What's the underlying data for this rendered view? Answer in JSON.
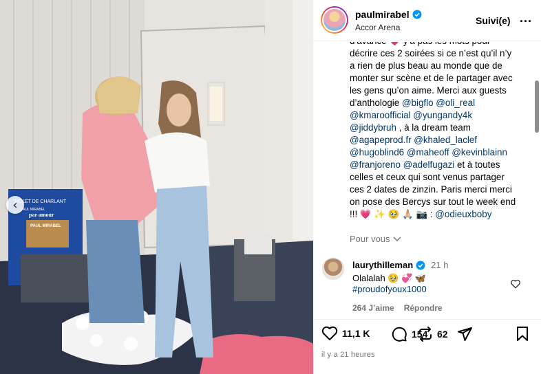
{
  "post": {
    "username": "paulmirabel",
    "location": "Accor Arena",
    "follow_label": "Suivi(e)",
    "more_label": "..."
  },
  "photo": {
    "ticket_line1": "TICKET DE CHARLANT",
    "ticket_line2": "PAUL MIRABEL",
    "ticket_line3": "par amour",
    "ticket_line4": "PAUL MIRABEL"
  },
  "caption": {
    "lines": [
      [
        {
          "t": "d’avance 💗 y’a pas les mots pour",
          "link": false
        }
      ],
      [
        {
          "t": "décrire ces 2 soirées si ce n’est qu’il n’y",
          "link": false
        }
      ],
      [
        {
          "t": "a rien de plus beau au monde que de",
          "link": false
        }
      ],
      [
        {
          "t": "monter sur scène et de le partager avec",
          "link": false
        }
      ],
      [
        {
          "t": "les gens qu’on aime. Merci aux guests",
          "link": false
        }
      ],
      [
        {
          "t": "d’anthologie ",
          "link": false
        },
        {
          "t": "@bigflo",
          "link": true
        },
        {
          "t": " ",
          "link": false
        },
        {
          "t": "@oli_real",
          "link": true
        }
      ],
      [
        {
          "t": "@kmaroofficial",
          "link": true
        },
        {
          "t": " ",
          "link": false
        },
        {
          "t": "@yungandy4k",
          "link": true
        }
      ],
      [
        {
          "t": "@jiddybruh",
          "link": true
        },
        {
          "t": " , à la dream team",
          "link": false
        }
      ],
      [
        {
          "t": "@agapeprod.fr",
          "link": true
        },
        {
          "t": " ",
          "link": false
        },
        {
          "t": "@khaled_laclef",
          "link": true
        }
      ],
      [
        {
          "t": "@hugoblind6",
          "link": true
        },
        {
          "t": " ",
          "link": false
        },
        {
          "t": "@maheoff",
          "link": true
        },
        {
          "t": " ",
          "link": false
        },
        {
          "t": "@kevinblainn",
          "link": true
        }
      ],
      [
        {
          "t": "@franjoreno",
          "link": true
        },
        {
          "t": " ",
          "link": false
        },
        {
          "t": "@adelfugazi",
          "link": true
        },
        {
          "t": " et à toutes",
          "link": false
        }
      ],
      [
        {
          "t": "celles et ceux qui sont venus partager",
          "link": false
        }
      ],
      [
        {
          "t": "ces 2 dates de zinzin. Paris merci merci",
          "link": false
        }
      ],
      [
        {
          "t": "on pose des Bercys sur tout le week end",
          "link": false
        }
      ],
      [
        {
          "t": "!!! 💗 ✨ 🥹 🙏🏼  📷 : ",
          "link": false
        },
        {
          "t": "@odieuxboby",
          "link": true
        }
      ]
    ]
  },
  "see_more_label": "Pour vous",
  "comment": {
    "username": "laurythilleman",
    "time": "21 h",
    "text": "Olalalah 🥹 💞 🦋",
    "hashtag": "#proudofyoux1000",
    "likes": "264 J’aime",
    "reply_label": "Répondre"
  },
  "actions": {
    "likes": "11,1 K",
    "comments": "154",
    "reposts": "62"
  },
  "time_ago": "il y a 21 heures",
  "colors": {
    "link": "#00376b",
    "verified": "#0095f6",
    "muted": "#737373"
  }
}
